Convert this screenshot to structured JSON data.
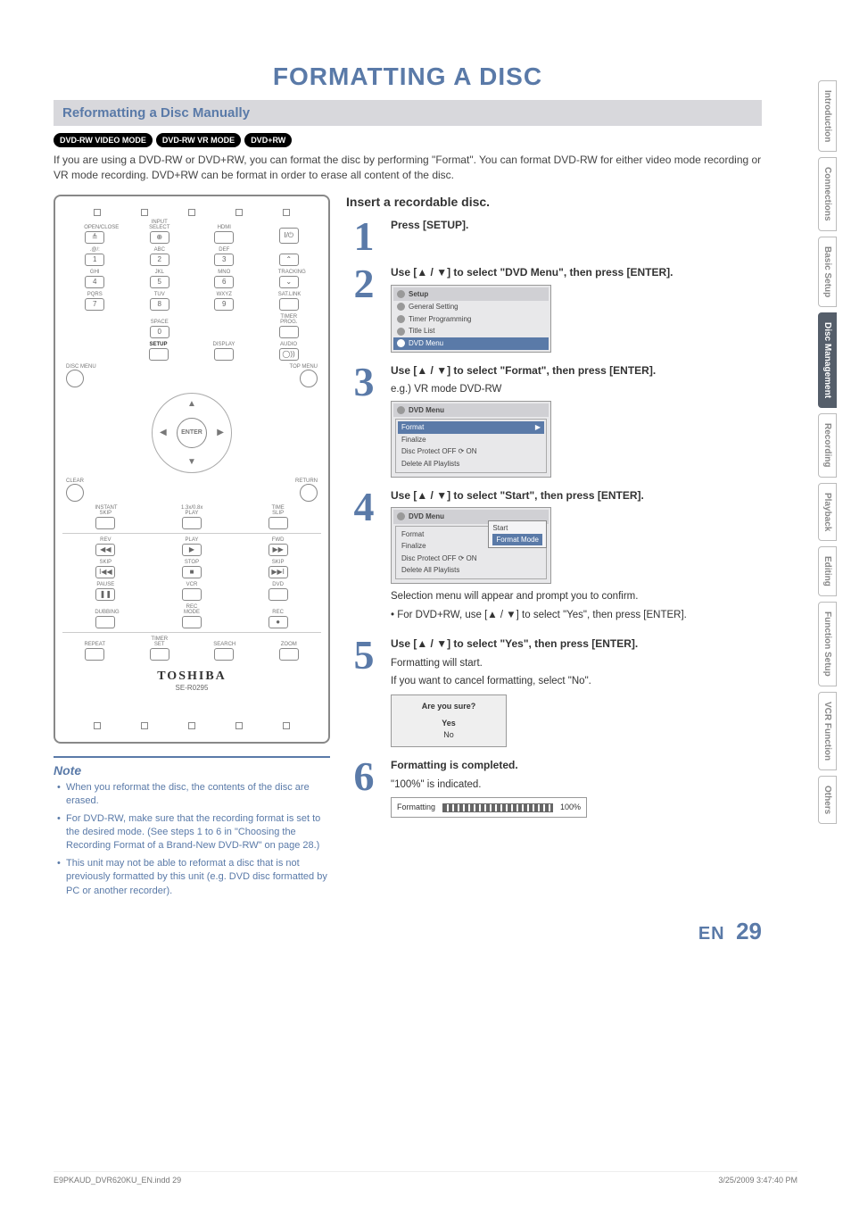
{
  "page_title": "FORMATTING A DISC",
  "section_title": "Reformatting a Disc Manually",
  "disc_badges": [
    "DVD-RW VIDEO MODE",
    "DVD-RW VR MODE",
    "DVD+RW"
  ],
  "intro": "If you are using a DVD-RW or DVD+RW, you can format the disc by performing \"Format\". You can format DVD-RW for either video mode recording or VR mode recording. DVD+RW can be format in order to erase all content of the disc.",
  "note_title": "Note",
  "notes": [
    "When you reformat the disc, the contents of the disc are erased.",
    "For DVD-RW, make sure that the recording format is set to the desired mode. (See steps 1 to 6 in \"Choosing the Recording Format of a Brand-New DVD-RW\" on page 28.)",
    "This unit may not be able to reformat a disc that is not previously formatted by this unit (e.g. DVD disc formatted by PC or another recorder)."
  ],
  "insert_heading": "Insert a recordable disc.",
  "steps": [
    {
      "num": "1",
      "instr": "Press [SETUP]."
    },
    {
      "num": "2",
      "instr": "Use [▲ / ▼] to select \"DVD Menu\", then press [ENTER].",
      "osd": {
        "header": "Setup",
        "lines": [
          "General Setting",
          "Timer Programming",
          "Title List",
          "DVD Menu"
        ],
        "highlight": "DVD Menu"
      }
    },
    {
      "num": "3",
      "instr": "Use [▲ / ▼] to select \"Format\", then press [ENTER].",
      "sub": "e.g.) VR mode DVD-RW",
      "osd": {
        "header": "DVD Menu",
        "lines": [
          "Format",
          "Finalize",
          "Disc Protect OFF ⟳ ON",
          "Delete All Playlists"
        ],
        "highlight": "Format"
      }
    },
    {
      "num": "4",
      "instr": "Use [▲ / ▼] to select \"Start\", then press [ENTER].",
      "osd": {
        "header": "DVD Menu",
        "lines": [
          "Format",
          "Finalize",
          "Disc Protect OFF ⟳ ON",
          "Delete All Playlists"
        ],
        "highlight": "Format",
        "popup": [
          "Start",
          "Format Mode"
        ],
        "popup_highlight": "Format Mode"
      },
      "after_lines": [
        "Selection menu will appear and prompt you to confirm.",
        "• For DVD+RW, use [▲ / ▼] to select \"Yes\", then press [ENTER]."
      ]
    },
    {
      "num": "5",
      "instr": "Use [▲ / ▼] to select \"Yes\", then press [ENTER].",
      "after_lines": [
        "Formatting will start.",
        "If you want to cancel formatting, select \"No\"."
      ],
      "dialog": {
        "title": "Are you sure?",
        "yes": "Yes",
        "no": "No"
      }
    },
    {
      "num": "6",
      "instr": "Formatting is completed.",
      "after_lines": [
        "\"100%\" is indicated."
      ],
      "progress": {
        "label": "Formatting",
        "percent": "100%"
      }
    }
  ],
  "remote": {
    "brand": "TOSHIBA",
    "model": "SE-R0295",
    "row_labels_1": [
      "OPEN/CLOSE",
      "INPUT SELECT",
      "HDMI",
      ""
    ],
    "row_labels_2": [
      ".@/:",
      "ABC",
      "DEF",
      ""
    ],
    "row_labels_3": [
      "GHI",
      "JKL",
      "MNO",
      "TRACKING"
    ],
    "row_labels_4": [
      "PQRS",
      "TUV",
      "WXYZ",
      "SAT.LINK"
    ],
    "row_labels_5": [
      "",
      "SPACE",
      "",
      "TIMER PROG."
    ],
    "row_labels_6": [
      "",
      "SETUP",
      "DISPLAY",
      "AUDIO"
    ],
    "nums": [
      "1",
      "2",
      "3",
      "4",
      "5",
      "6",
      "7",
      "8",
      "9",
      "0"
    ],
    "nav_enter": "ENTER",
    "disc_menu": "DISC MENU",
    "top_menu": "TOP MENU",
    "clear": "CLEAR",
    "return": "RETURN",
    "mid_labels": [
      "INSTANT SKIP",
      "1.3x/0.8x PLAY",
      "TIME SLIP"
    ],
    "transport1": [
      "REV",
      "PLAY",
      "FWD"
    ],
    "transport2": [
      "SKIP",
      "STOP",
      "SKIP"
    ],
    "transport3": [
      "PAUSE",
      "VCR",
      "DVD"
    ],
    "transport4": [
      "DUBBING",
      "REC MODE",
      "REC"
    ],
    "bottom": [
      "REPEAT",
      "TIMER SET",
      "SEARCH",
      "ZOOM"
    ]
  },
  "page_lang": "EN",
  "page_number": "29",
  "footer_file": "E9PKAUD_DVR620KU_EN.indd   29",
  "footer_time": "3/25/2009   3:47:40 PM",
  "tabs": [
    "Introduction",
    "Connections",
    "Basic Setup",
    "Disc Management",
    "Recording",
    "Playback",
    "Editing",
    "Function Setup",
    "VCR Function",
    "Others"
  ],
  "active_tab": "Disc Management"
}
